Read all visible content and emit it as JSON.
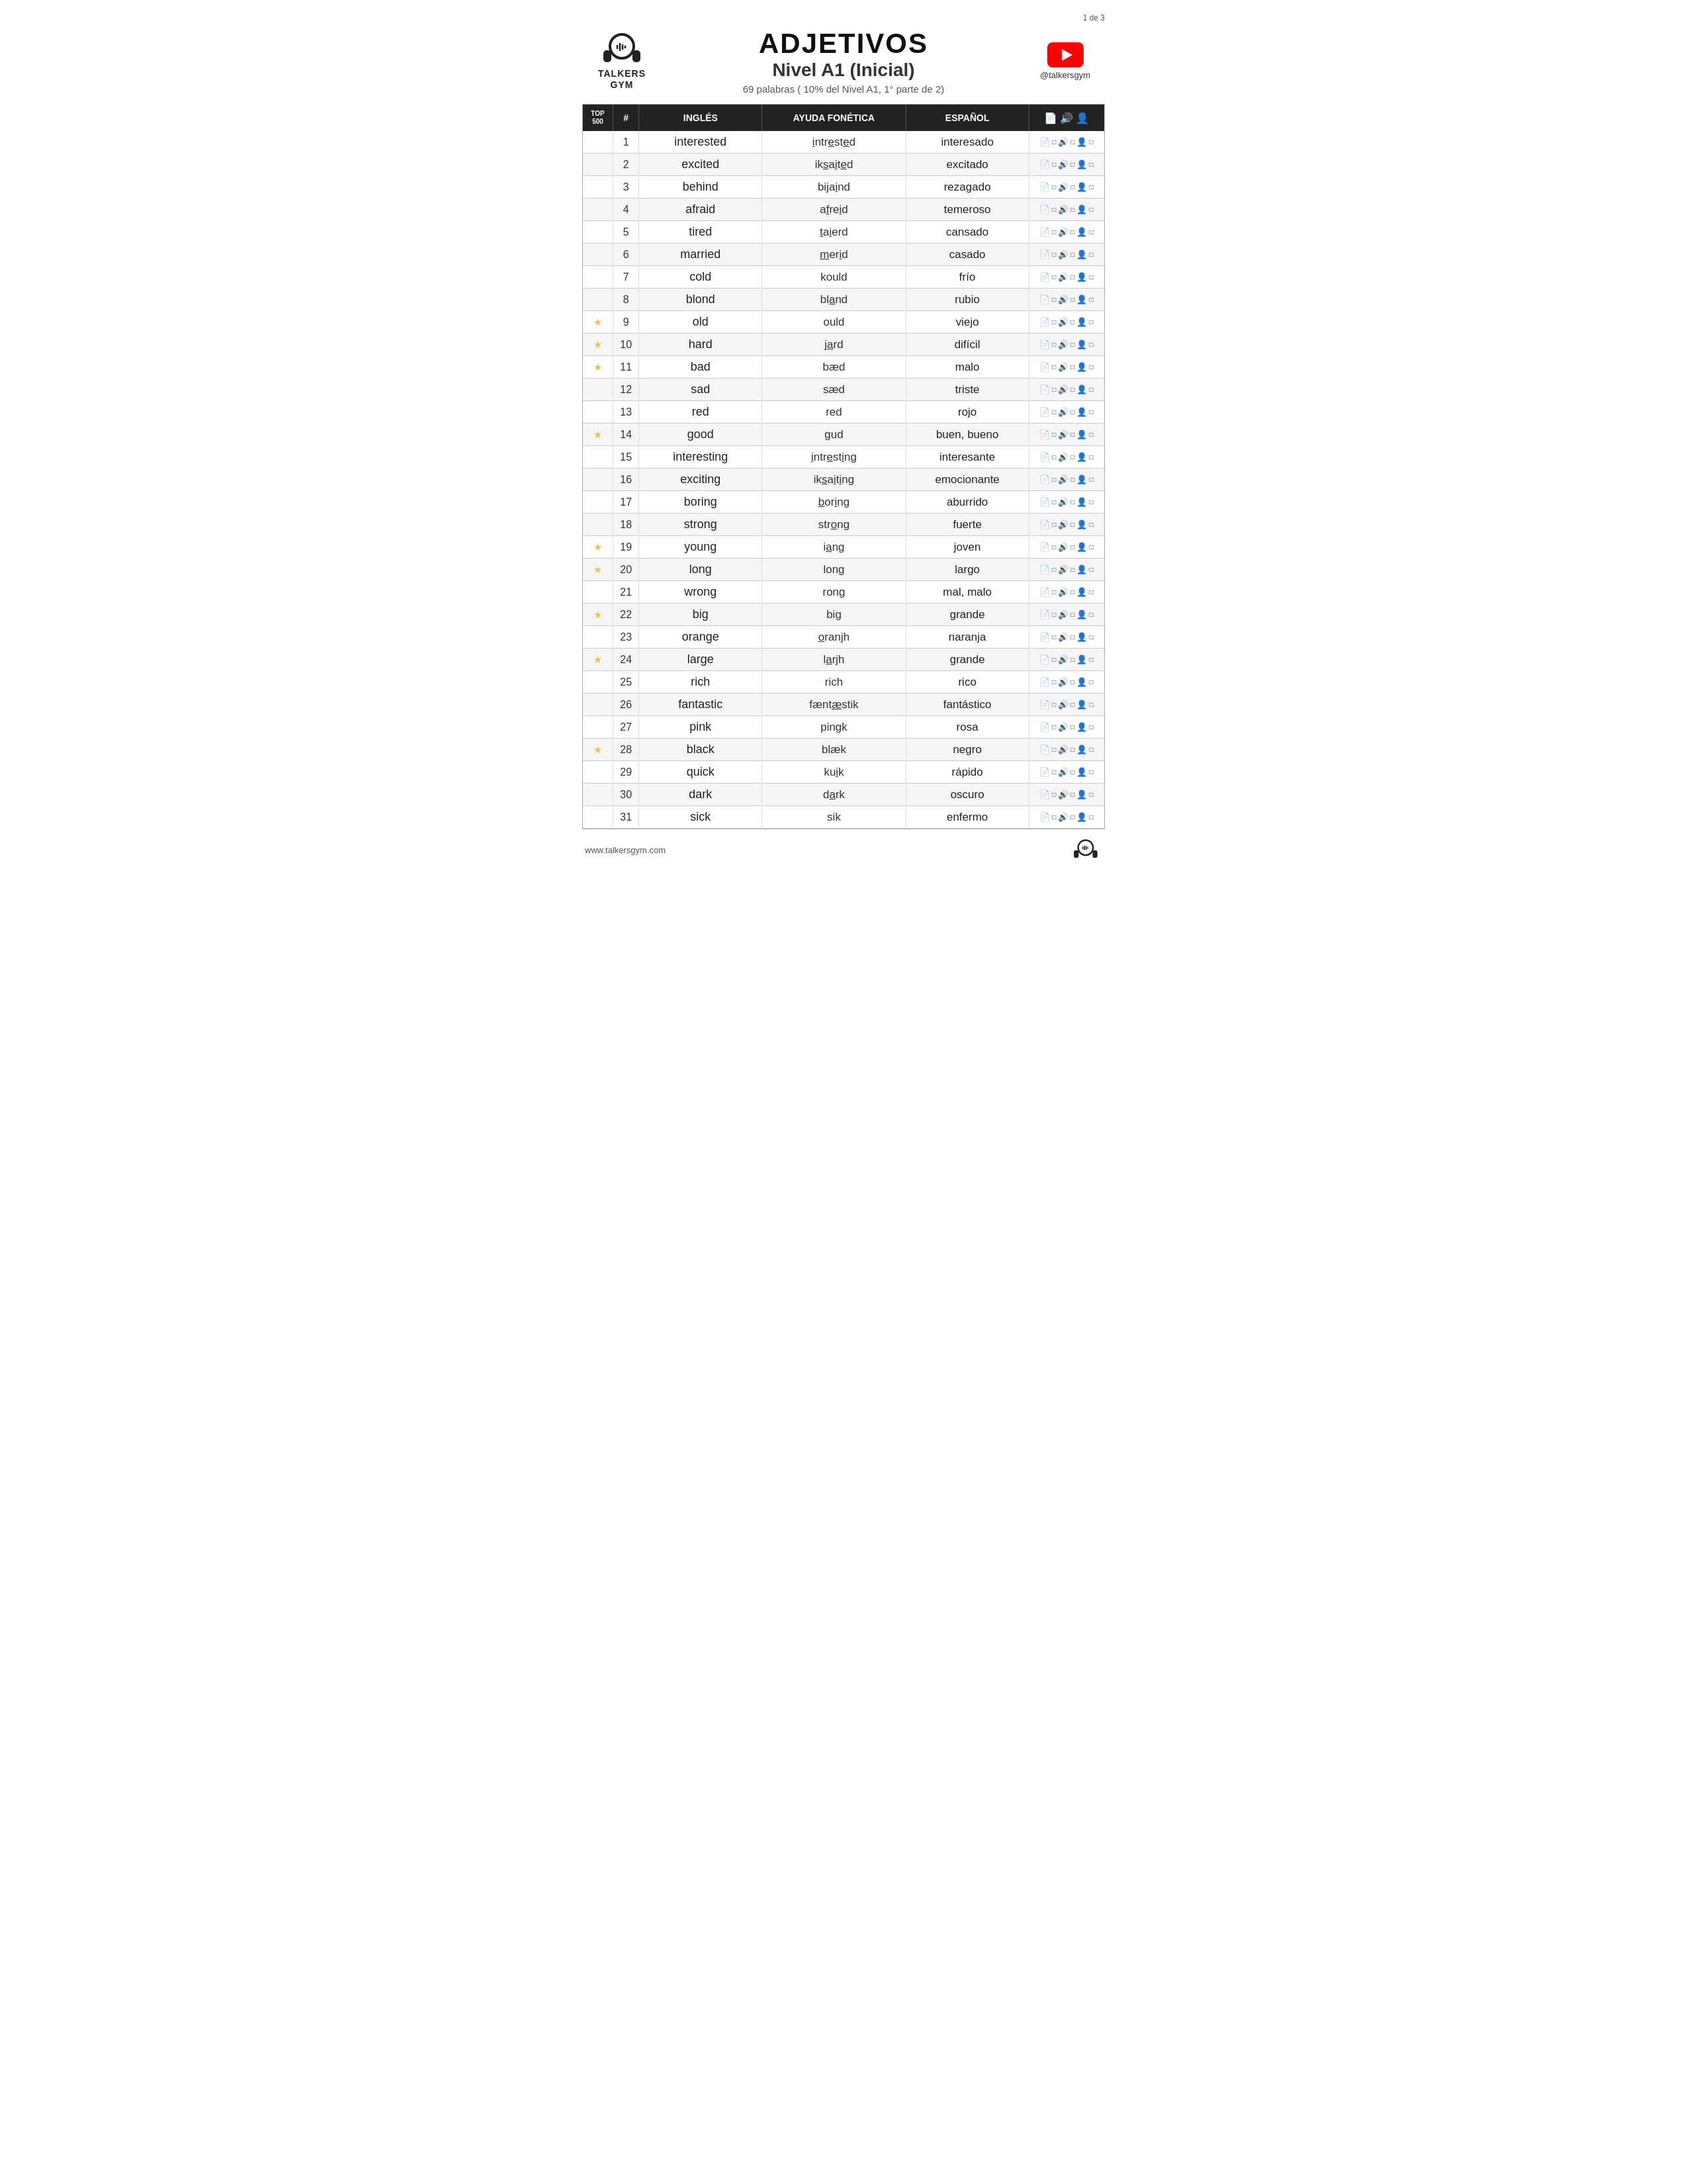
{
  "page": {
    "number": "1 de 3",
    "logo_line1": "TALKERS",
    "logo_line2": "GYM",
    "main_title": "ADJETIVOS",
    "subtitle": "Nivel A1 (Inicial)",
    "subtitle_small": "69 palabras ( 10% del Nivel A1, 1° parte de 2)",
    "yt_handle": "@talkersgym",
    "footer_url": "www.talkersgym.com"
  },
  "columns": {
    "top500": "TOP 500",
    "num": "#",
    "ingles": "INGLÉS",
    "fonetica": "AYUDA FONÉTICA",
    "espanol": "ESPAÑOL",
    "icons": "📄🔊👤"
  },
  "rows": [
    {
      "num": 1,
      "star": false,
      "ingles": "interested",
      "fonetica": "<u>i</u>ntr<u>e</u>st<u>e</u>d",
      "espanol": "interesado"
    },
    {
      "num": 2,
      "star": false,
      "ingles": "excited",
      "fonetica": "ik<u>s</u>a<u>i</u>t<u>e</u>d",
      "espanol": "excitado"
    },
    {
      "num": 3,
      "star": false,
      "ingles": "behind",
      "fonetica": "bija<u>i</u>nd",
      "espanol": "rezagado"
    },
    {
      "num": 4,
      "star": false,
      "ingles": "afraid",
      "fonetica": "a<u>f</u>re<u>i</u>d",
      "espanol": "temeroso"
    },
    {
      "num": 5,
      "star": false,
      "ingles": "tired",
      "fonetica": "<u>t</u>a<u>i</u>erd",
      "espanol": "cansado"
    },
    {
      "num": 6,
      "star": false,
      "ingles": "married",
      "fonetica": "<u>m</u>er<u>i</u>d",
      "espanol": "casado"
    },
    {
      "num": 7,
      "star": false,
      "ingles": "cold",
      "fonetica": "kould",
      "espanol": "frío"
    },
    {
      "num": 8,
      "star": false,
      "ingles": "blond",
      "fonetica": "bl<u>a</u>nd",
      "espanol": "rubio"
    },
    {
      "num": 9,
      "star": true,
      "ingles": "old",
      "fonetica": "ould",
      "espanol": "viejo"
    },
    {
      "num": 10,
      "star": true,
      "ingles": "hard",
      "fonetica": "j<u>a</u>rd",
      "espanol": "difícil"
    },
    {
      "num": 11,
      "star": true,
      "ingles": "bad",
      "fonetica": "bæd",
      "espanol": "malo"
    },
    {
      "num": 12,
      "star": false,
      "ingles": "sad",
      "fonetica": "sæd",
      "espanol": "triste"
    },
    {
      "num": 13,
      "star": false,
      "ingles": "red",
      "fonetica": "red",
      "espanol": "rojo"
    },
    {
      "num": 14,
      "star": true,
      "ingles": "good",
      "fonetica": "gud",
      "espanol": "buen, bueno"
    },
    {
      "num": 15,
      "star": false,
      "ingles": "interesting",
      "fonetica": "<u>i</u>ntr<u>e</u>st<u>i</u>ng",
      "espanol": "interesante"
    },
    {
      "num": 16,
      "star": false,
      "ingles": "exciting",
      "fonetica": "ik<u>s</u>a<u>i</u>t<u>i</u>ng",
      "espanol": "emocionante"
    },
    {
      "num": 17,
      "star": false,
      "ingles": "boring",
      "fonetica": "<u>b</u>or<u>i</u>ng",
      "espanol": "aburrido"
    },
    {
      "num": 18,
      "star": false,
      "ingles": "strong",
      "fonetica": "str<u>o</u>ng",
      "espanol": "fuerte"
    },
    {
      "num": 19,
      "star": true,
      "ingles": "young",
      "fonetica": "i<u>a</u>ng",
      "espanol": "joven"
    },
    {
      "num": 20,
      "star": true,
      "ingles": "long",
      "fonetica": "long",
      "espanol": "largo"
    },
    {
      "num": 21,
      "star": false,
      "ingles": "wrong",
      "fonetica": "rong",
      "espanol": "mal, malo"
    },
    {
      "num": 22,
      "star": true,
      "ingles": "big",
      "fonetica": "big",
      "espanol": "grande"
    },
    {
      "num": 23,
      "star": false,
      "ingles": "orange",
      "fonetica": "<u>o</u>ranjh",
      "espanol": "naranja"
    },
    {
      "num": 24,
      "star": true,
      "ingles": "large",
      "fonetica": "l<u>a</u>rjh",
      "espanol": "grande"
    },
    {
      "num": 25,
      "star": false,
      "ingles": "rich",
      "fonetica": "rich",
      "espanol": "rico"
    },
    {
      "num": 26,
      "star": false,
      "ingles": "fantastic",
      "fonetica": "fænt<u>æ</u>stik",
      "espanol": "fantástico"
    },
    {
      "num": 27,
      "star": false,
      "ingles": "pink",
      "fonetica": "pingk",
      "espanol": "rosa"
    },
    {
      "num": 28,
      "star": true,
      "ingles": "black",
      "fonetica": "blæk",
      "espanol": "negro"
    },
    {
      "num": 29,
      "star": false,
      "ingles": "quick",
      "fonetica": "ku<u>i</u>k",
      "espanol": "rápido"
    },
    {
      "num": 30,
      "star": false,
      "ingles": "dark",
      "fonetica": "d<u>a</u>rk",
      "espanol": "oscuro"
    },
    {
      "num": 31,
      "star": false,
      "ingles": "sick",
      "fonetica": "sik",
      "espanol": "enfermo"
    }
  ]
}
